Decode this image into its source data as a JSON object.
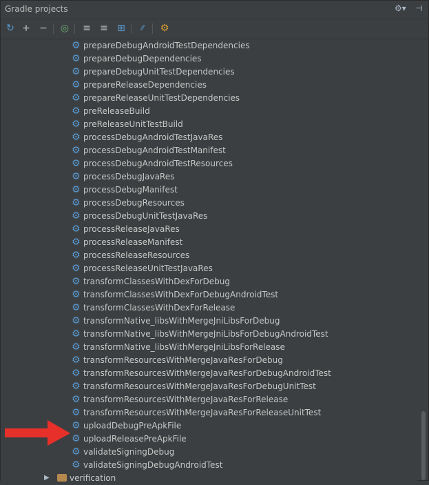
{
  "panel": {
    "title": "Gradle projects",
    "settings_icon": "gear-icon",
    "hide_icon": "hide-pin-icon"
  },
  "toolbar": {
    "refresh": "↻",
    "add": "+",
    "remove": "−",
    "run": "◎",
    "expand": "≡",
    "collapse": "≡",
    "link": "⊞",
    "offline": "⁄⁄",
    "settings": "⚙"
  },
  "tasks": [
    "prepareDebugAndroidTestDependencies",
    "prepareDebugDependencies",
    "prepareDebugUnitTestDependencies",
    "prepareReleaseDependencies",
    "prepareReleaseUnitTestDependencies",
    "preReleaseBuild",
    "preReleaseUnitTestBuild",
    "processDebugAndroidTestJavaRes",
    "processDebugAndroidTestManifest",
    "processDebugAndroidTestResources",
    "processDebugJavaRes",
    "processDebugManifest",
    "processDebugResources",
    "processDebugUnitTestJavaRes",
    "processReleaseJavaRes",
    "processReleaseManifest",
    "processReleaseResources",
    "processReleaseUnitTestJavaRes",
    "transformClassesWithDexForDebug",
    "transformClassesWithDexForDebugAndroidTest",
    "transformClassesWithDexForRelease",
    "transformNative_libsWithMergeJniLibsForDebug",
    "transformNative_libsWithMergeJniLibsForDebugAndroidTest",
    "transformNative_libsWithMergeJniLibsForRelease",
    "transformResourcesWithMergeJavaResForDebug",
    "transformResourcesWithMergeJavaResForDebugAndroidTest",
    "transformResourcesWithMergeJavaResForDebugUnitTest",
    "transformResourcesWithMergeJavaResForRelease",
    "transformResourcesWithMergeJavaResForReleaseUnitTest",
    "uploadDebugPreApkFile",
    "uploadReleasePreApkFile",
    "validateSigningDebug",
    "validateSigningDebugAndroidTest"
  ],
  "folder": {
    "label": "verification"
  },
  "colors": {
    "accent": "#5a9bd4",
    "arrow": "#e8302a"
  }
}
